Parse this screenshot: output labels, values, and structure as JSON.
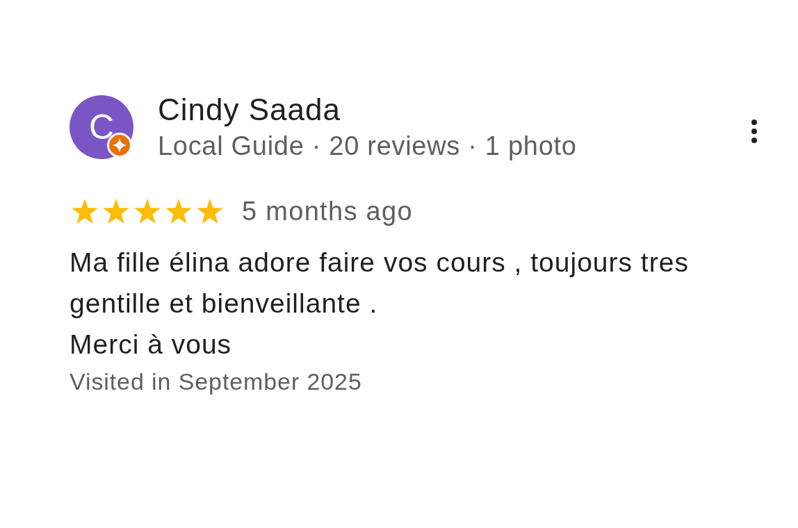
{
  "review": {
    "author": {
      "initial": "C",
      "name": "Cindy Saada",
      "local_guide": true,
      "meta": "Local Guide · 20 reviews · 1 photo"
    },
    "stars": 5,
    "time": "5 months ago",
    "paragraphs": [
      "Ma fille élina adore faire vos cours , toujours tres gentille et bienveillante .",
      "Merci à vous"
    ],
    "visited": "Visited in September 2025"
  }
}
